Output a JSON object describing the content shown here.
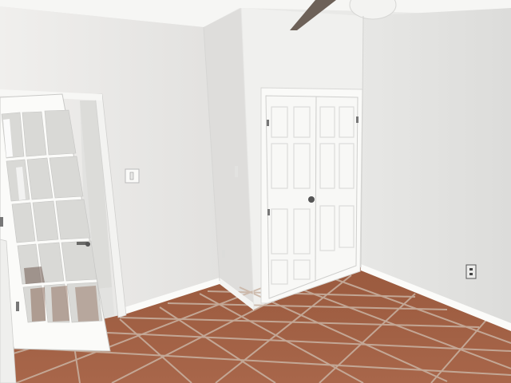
{
  "scene": {
    "description_free": true,
    "colors": {
      "wall_left": "#ecebe9",
      "wall_center": "#f1f0ee",
      "wall_right": "#e4e4e2",
      "ceiling": "#f5f5f3",
      "floor_tile": "#a35f42",
      "grout": "#c8b6a8",
      "trim": "#fafaf8",
      "door": "#f7f7f5"
    }
  }
}
